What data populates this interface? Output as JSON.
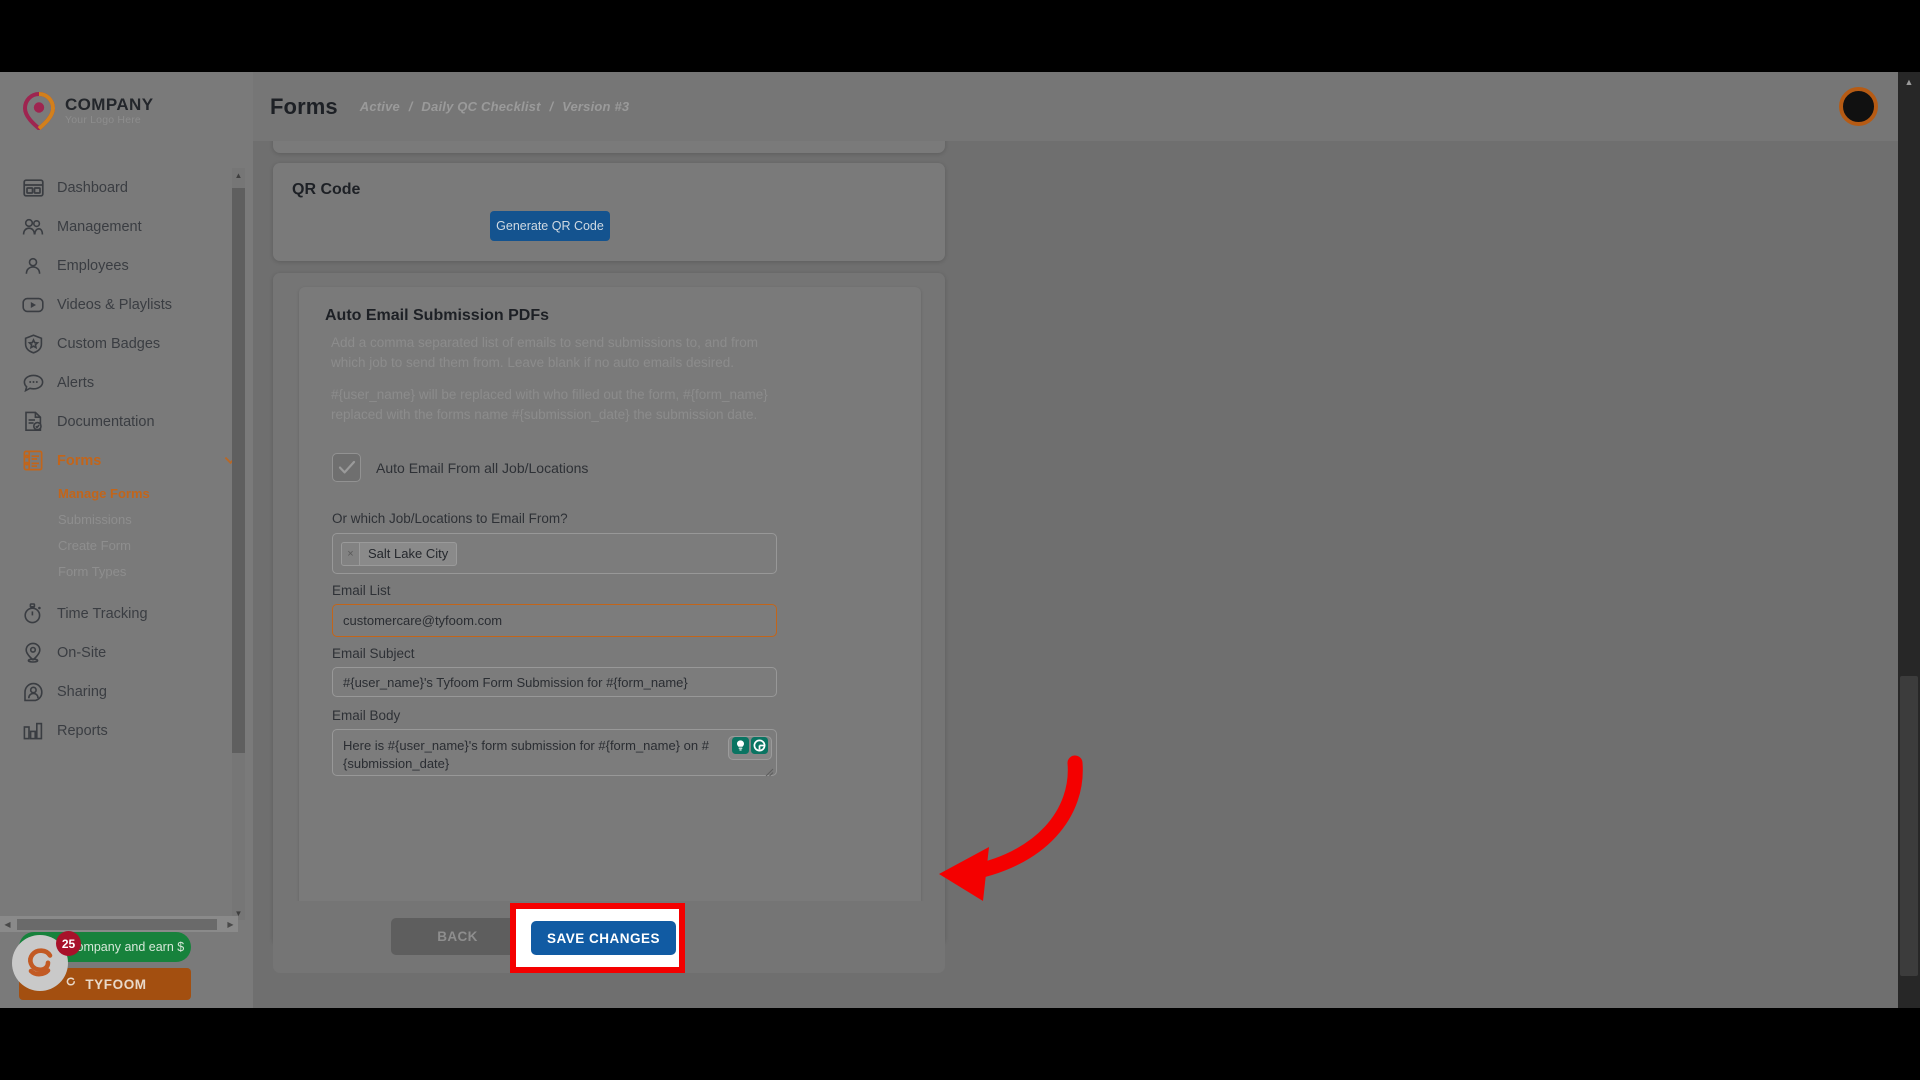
{
  "brand": {
    "title": "COMPANY",
    "subtitle": "Your Logo Here",
    "logo_icon": "location-pin-logo-icon"
  },
  "header": {
    "page_title": "Forms",
    "breadcrumb": {
      "items": [
        "Active",
        "Daily QC Checklist",
        "Version #3"
      ],
      "separator": "/"
    },
    "avatar_name": "user-avatar",
    "avatar_border_color": "#b65b14"
  },
  "sidebar": {
    "items": [
      {
        "label": "Dashboard",
        "icon": "dashboard-icon",
        "has_chevron": false,
        "active": false
      },
      {
        "label": "Management",
        "icon": "users-group-icon",
        "has_chevron": true,
        "active": false
      },
      {
        "label": "Employees",
        "icon": "user-icon",
        "has_chevron": true,
        "active": false
      },
      {
        "label": "Videos & Playlists",
        "icon": "video-play-icon",
        "has_chevron": true,
        "active": false
      },
      {
        "label": "Custom Badges",
        "icon": "badge-star-icon",
        "has_chevron": false,
        "active": false
      },
      {
        "label": "Alerts",
        "icon": "chat-bubble-icon",
        "has_chevron": true,
        "active": false
      },
      {
        "label": "Documentation",
        "icon": "document-check-icon",
        "has_chevron": true,
        "active": false
      },
      {
        "label": "Forms",
        "icon": "forms-list-icon",
        "has_chevron": true,
        "active": true,
        "expanded": true
      },
      {
        "label": "Time Tracking",
        "icon": "stopwatch-icon",
        "has_chevron": true,
        "active": false
      },
      {
        "label": "On-Site",
        "icon": "map-pin-icon",
        "has_chevron": true,
        "active": false
      },
      {
        "label": "Sharing",
        "icon": "share-person-icon",
        "has_chevron": true,
        "active": false
      },
      {
        "label": "Reports",
        "icon": "bar-chart-icon",
        "has_chevron": true,
        "active": false
      }
    ],
    "forms_submenu": [
      {
        "label": "Manage Forms",
        "active": true
      },
      {
        "label": "Submissions",
        "active": false
      },
      {
        "label": "Create Form",
        "active": false
      },
      {
        "label": "Form Types",
        "active": false
      }
    ],
    "active_color": "#c2651a",
    "chevron_right": "›",
    "chevron_down": "⌄"
  },
  "promo": {
    "refer_label": "Refer a company and earn $",
    "badge_count": "25",
    "tyfoom_label": "TYFOOM",
    "refer_color": "#17823c",
    "tyfoom_color": "#a34f10",
    "badge_color": "#a8112a"
  },
  "qr_card": {
    "heading": "QR Code",
    "generate_button": "Generate QR Code",
    "button_color": "#14538f"
  },
  "auto_email": {
    "heading": "Auto Email Submission PDFs",
    "description_1": "Add a comma separated list of emails to send submissions to, and from which job to send them from. Leave blank if no auto emails desired.",
    "description_2": "#{user_name} will be replaced with who filled out the form, #{form_name} replaced with the forms name #{submission_date} the submission date.",
    "checkbox": {
      "label": "Auto Email From all Job/Locations",
      "checked": true,
      "check_glyph": "✓"
    },
    "job_locations": {
      "label": "Or which Job/Locations to Email From?",
      "chips": [
        {
          "text": "Salt Lake City",
          "remove_glyph": "×"
        }
      ]
    },
    "email_list": {
      "label": "Email List",
      "value": "customercare@tyfoom.com",
      "focused": true,
      "focus_color": "#c2651a"
    },
    "email_subject": {
      "label": "Email Subject",
      "value": "#{user_name}'s Tyfoom Form Submission for #{form_name}"
    },
    "email_body": {
      "label": "Email Body",
      "value": "Here is #{user_name}'s form submission for #{form_name} on #{submission_date}",
      "assistant_icons": [
        "lightbulb-icon",
        "grammarly-g-icon"
      ],
      "assistant_color": "#0a7462"
    }
  },
  "footer": {
    "back_label": "BACK",
    "save_label": "SAVE CHANGES",
    "save_color": "#115ba3",
    "back_disabled": true
  },
  "annotation": {
    "highlight_color": "#f40000",
    "highlight_target": "save-changes-button",
    "arrow_name": "red-curved-arrow-pointing-left",
    "arrow_color": "#f40000"
  },
  "scrollbars": {
    "page_scroll_up": "▲",
    "page_scroll_down": "▼",
    "sidebar_left_arrow": "◀",
    "sidebar_right_arrow": "▶"
  }
}
